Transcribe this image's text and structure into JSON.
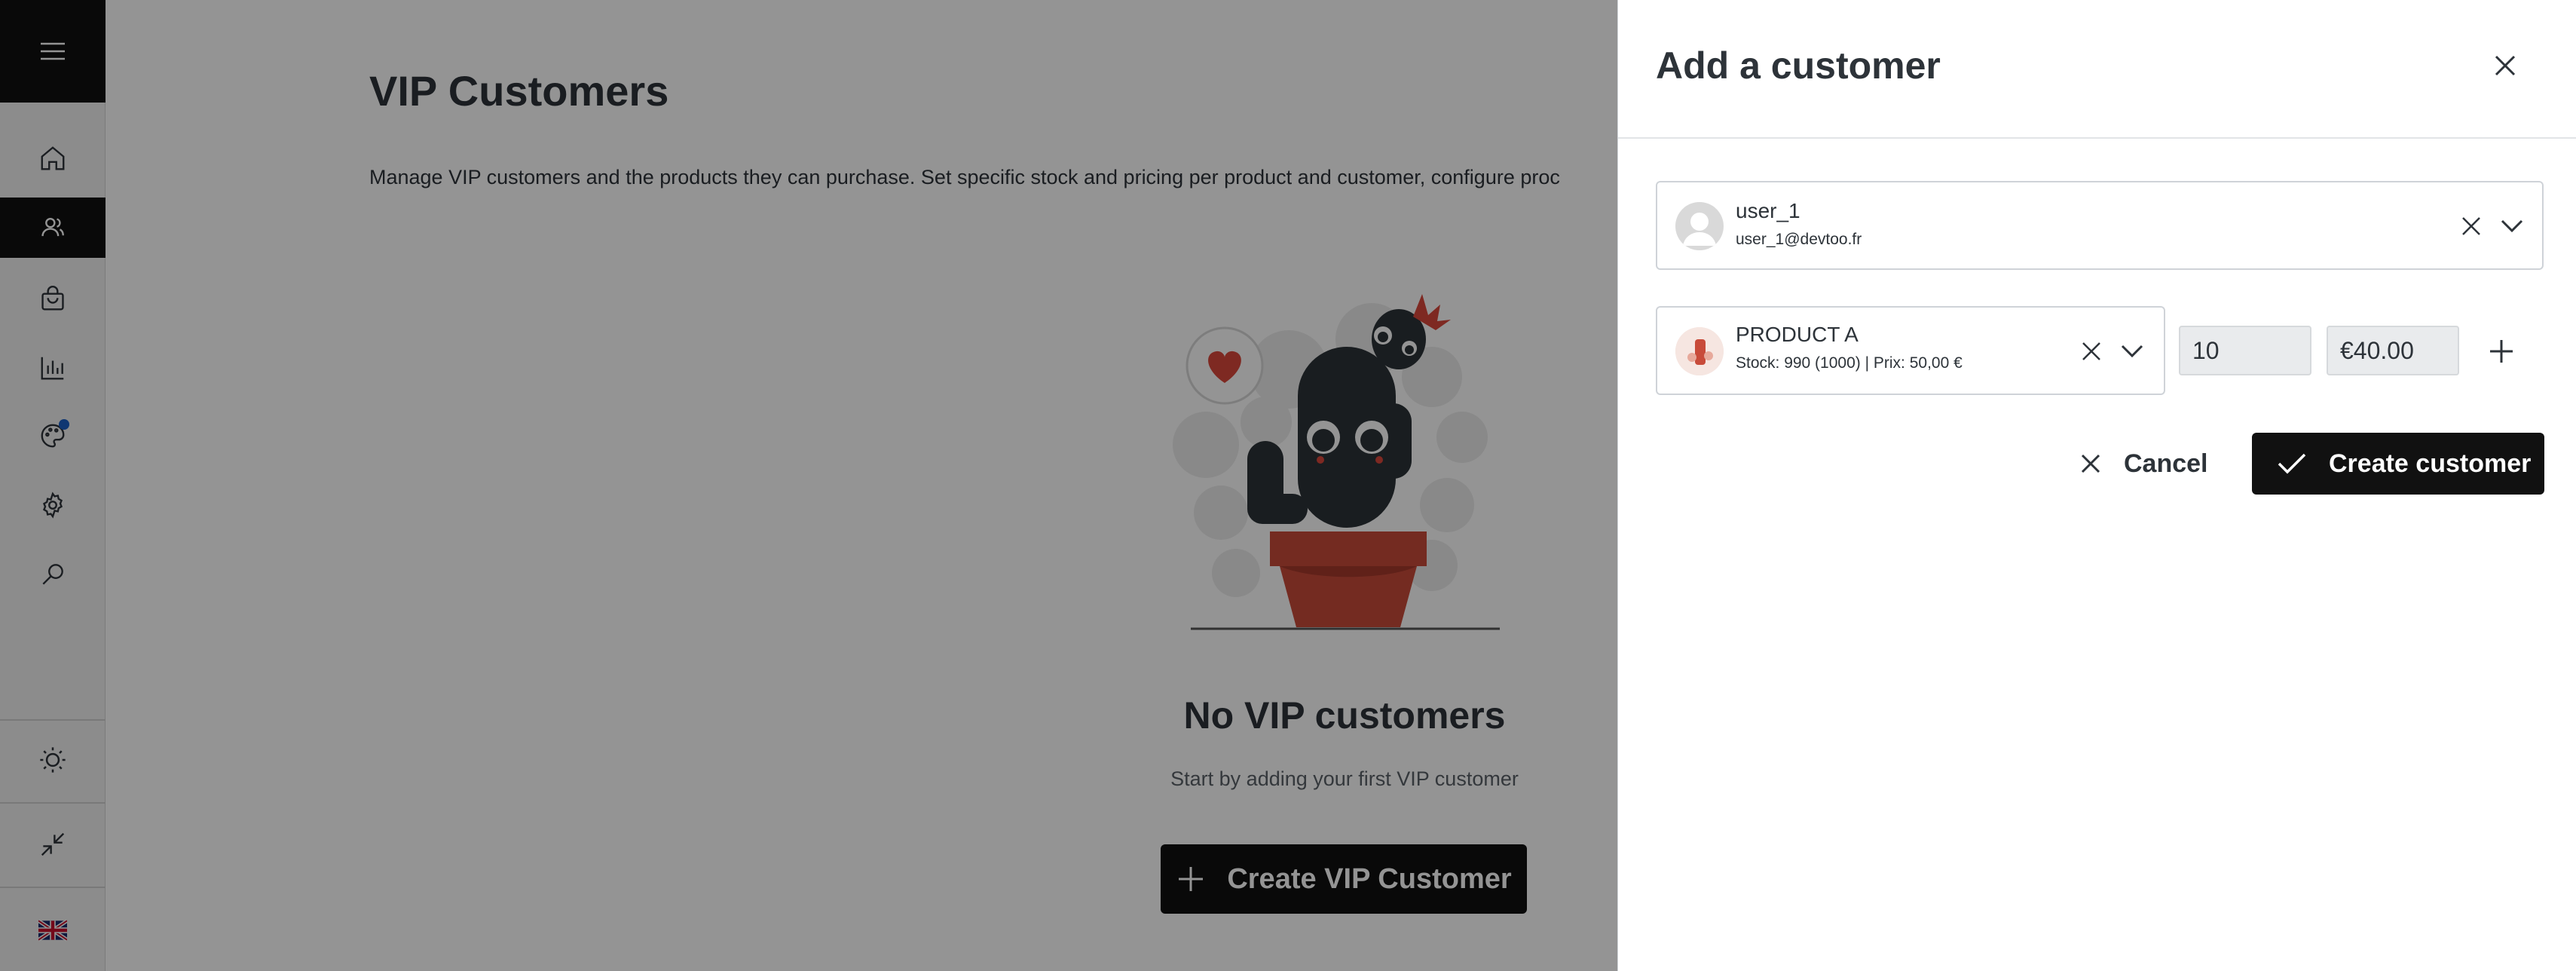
{
  "sidebar": {
    "menu_icon": "hamburger-icon",
    "items": [
      {
        "name": "home",
        "icon": "home-icon",
        "active": false
      },
      {
        "name": "vip-customers",
        "icon": "users-icon",
        "active": true
      },
      {
        "name": "products",
        "icon": "shopping-bag-icon",
        "active": false
      },
      {
        "name": "statistics",
        "icon": "bar-chart-icon",
        "active": false
      },
      {
        "name": "appearance",
        "icon": "palette-icon",
        "active": false,
        "notification_dot": true
      },
      {
        "name": "settings",
        "icon": "gear-icon",
        "active": false
      },
      {
        "name": "search",
        "icon": "search-icon",
        "active": false
      }
    ],
    "bottom": [
      "sun-icon",
      "collapse-icon",
      "uk-flag-icon"
    ]
  },
  "main": {
    "title": "VIP Customers",
    "description": "Manage VIP customers and the products they can purchase. Set specific stock and pricing per product and customer, configure proc",
    "empty_title": "No VIP customers",
    "empty_subtitle": "Start by adding your first VIP customer",
    "create_button": "Create VIP Customer"
  },
  "panel": {
    "title": "Add a customer",
    "customer": {
      "username": "user_1",
      "email": "user_1@devtoo.fr"
    },
    "product": {
      "name": "PRODUCT A",
      "details": "Stock: 990 (1000) | Prix: 50,00 €",
      "quantity": "10",
      "price": "€40.00"
    },
    "cancel_label": "Cancel",
    "create_label": "Create customer"
  },
  "colors": {
    "accent": "#111111",
    "notification": "#1a5fc4",
    "cactus": "#2c3338",
    "pot": "#c84b3a"
  }
}
